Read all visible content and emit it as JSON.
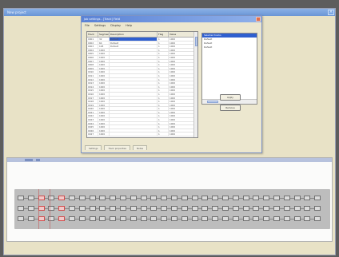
{
  "outer_window": {
    "title": "New project"
  },
  "dialog": {
    "title": "Job settings - [Track] Field",
    "menu": [
      "File",
      "Settings",
      "Display",
      "Help"
    ],
    "grid": {
      "headers": [
        "Track",
        "Segment",
        "Description",
        "Flag",
        "Value"
      ],
      "rows": [
        [
          "0001",
          "32",
          "Default",
          "1",
          "1000"
        ],
        [
          "0002",
          "64",
          "Default",
          "1",
          "1000"
        ],
        [
          "0003",
          "128",
          "Default",
          "1",
          "1000"
        ],
        [
          "0004",
          "1000",
          "",
          "1",
          "1000"
        ],
        [
          "0005",
          "1000",
          "",
          "1",
          "1000"
        ],
        [
          "0006",
          "1000",
          "",
          "1",
          "1000"
        ],
        [
          "0007",
          "1000",
          "",
          "1",
          "1000"
        ],
        [
          "0008",
          "1000",
          "",
          "1",
          "1000"
        ],
        [
          "0009",
          "1000",
          "",
          "1",
          "1000"
        ],
        [
          "0010",
          "1000",
          "",
          "1",
          "1000"
        ],
        [
          "0011",
          "1000",
          "",
          "1",
          "1000"
        ],
        [
          "0012",
          "1000",
          "",
          "1",
          "1000"
        ],
        [
          "0013",
          "1000",
          "",
          "1",
          "1000"
        ],
        [
          "0014",
          "1000",
          "",
          "1",
          "1000"
        ],
        [
          "0015",
          "1000",
          "",
          "1",
          "1000"
        ],
        [
          "0016",
          "1000",
          "",
          "1",
          "1000"
        ],
        [
          "0017",
          "1000",
          "",
          "1",
          "1000"
        ],
        [
          "0018",
          "1000",
          "",
          "1",
          "1000"
        ],
        [
          "0019",
          "1000",
          "",
          "1",
          "1000"
        ],
        [
          "0020",
          "1000",
          "",
          "1",
          "1000"
        ],
        [
          "0021",
          "1000",
          "",
          "1",
          "1000"
        ],
        [
          "0022",
          "1000",
          "",
          "1",
          "1000"
        ],
        [
          "0023",
          "1000",
          "",
          "1",
          "1000"
        ],
        [
          "0024",
          "1000",
          "",
          "1",
          "1000"
        ],
        [
          "0025",
          "1000",
          "",
          "1",
          "1000"
        ],
        [
          "0026",
          "1000",
          "",
          "1",
          "1000"
        ],
        [
          "0027",
          "1000",
          "",
          "1",
          "1000"
        ]
      ]
    },
    "listbox": {
      "header": "Selected tracks",
      "items": [
        "Default",
        "Default",
        "Default"
      ]
    },
    "buttons": {
      "apply": "Apply",
      "remove": "Remove"
    },
    "tabs": [
      "Settings",
      "Track properties",
      "Notes"
    ]
  },
  "colors": {
    "accent": "#2f5fcf",
    "titlebar": "#6a95d5",
    "highlight_segment": "#d24d4d"
  }
}
